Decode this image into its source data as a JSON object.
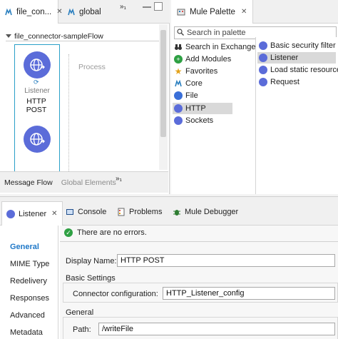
{
  "editor": {
    "tabs": [
      {
        "label": "file_con..."
      },
      {
        "label": "global"
      }
    ],
    "overflow_badge": "»₁",
    "flow": {
      "name": "file_connector-sampleFlow",
      "process_label": "Process",
      "source_node": {
        "subtitle": "Listener",
        "name": "HTTP POST"
      }
    },
    "bottom_tabs": [
      {
        "label": "Message Flow"
      },
      {
        "label": "Global Elements"
      }
    ],
    "bottom_overflow": "»₁"
  },
  "palette": {
    "title": "Mule Palette",
    "search_placeholder": "Search in palette",
    "categories": [
      {
        "label": "Search in Exchange...",
        "icon": "binoculars-icon"
      },
      {
        "label": "Add Modules",
        "icon": "plus-icon"
      },
      {
        "label": "Favorites",
        "icon": "star-icon"
      },
      {
        "label": "Core",
        "icon": "mule-icon"
      },
      {
        "label": "File",
        "icon": "file-icon"
      },
      {
        "label": "HTTP",
        "icon": "http-icon"
      },
      {
        "label": "Sockets",
        "icon": "sockets-icon"
      }
    ],
    "selected_category": "HTTP",
    "operations": [
      {
        "label": "Basic security filter"
      },
      {
        "label": "Listener"
      },
      {
        "label": "Load static resource"
      },
      {
        "label": "Request"
      }
    ],
    "selected_operation": "Listener"
  },
  "properties": {
    "tabs": [
      {
        "label": "Listener"
      },
      {
        "label": "Console"
      },
      {
        "label": "Problems"
      },
      {
        "label": "Mule Debugger"
      }
    ],
    "sidebar": [
      {
        "label": "General"
      },
      {
        "label": "MIME Type"
      },
      {
        "label": "Redelivery"
      },
      {
        "label": "Responses"
      },
      {
        "label": "Advanced"
      },
      {
        "label": "Metadata"
      }
    ],
    "status": "There are no errors.",
    "display_name_label": "Display Name:",
    "display_name_value": "HTTP POST",
    "basic_settings_title": "Basic Settings",
    "connector_config_label": "Connector configuration:",
    "connector_config_value": "HTTP_Listener_config",
    "general_title": "General",
    "path_label": "Path:",
    "path_value": "/writeFile"
  },
  "colors": {
    "accent": "#1f78c8",
    "node": "#5b6cd9",
    "selection_border": "#2aa0c8",
    "ok": "#2ea043"
  }
}
